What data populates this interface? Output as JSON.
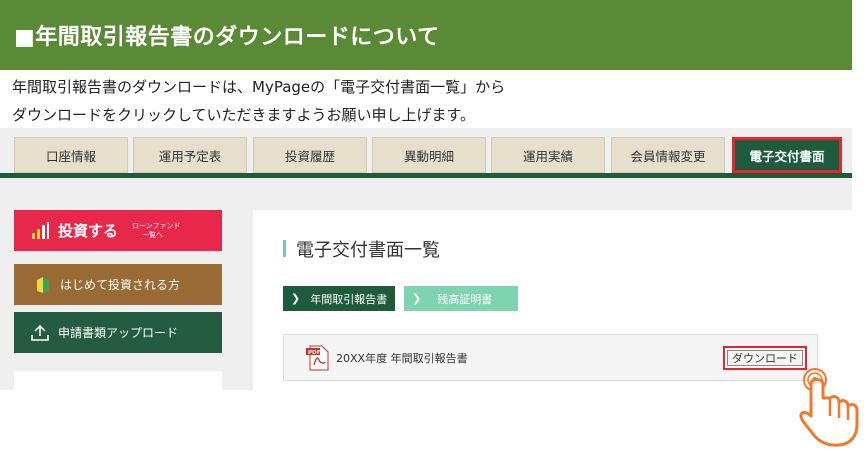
{
  "banner": {
    "title": "■年間取引報告書のダウンロードについて"
  },
  "intro": {
    "line1": "年間取引報告書のダウンロードは、MyPageの「電子交付書面一覧」から",
    "line2": "ダウンロードをクリックしていただきますようお願い申し上げます。"
  },
  "tabs": [
    {
      "label": "口座情報"
    },
    {
      "label": "運用予定表"
    },
    {
      "label": "投資履歴"
    },
    {
      "label": "異動明細"
    },
    {
      "label": "運用実績"
    },
    {
      "label": "会員情報変更"
    },
    {
      "label": "電子交付書面",
      "active": true
    }
  ],
  "sidebar": {
    "invest_label": "投資する",
    "invest_sub_line1": "ローンファンド",
    "invest_sub_line2": "一覧へ",
    "beginner_label": "はじめて投資される方",
    "upload_label": "申請書類アップロード"
  },
  "panel": {
    "title": "電子交付書面一覧",
    "subtabs": [
      {
        "label": "年間取引報告書",
        "active": true
      },
      {
        "label": "残高証明書",
        "active": false
      }
    ],
    "document": {
      "pdf_badge": "PDF",
      "name": "20XX年度 年間取引報告書",
      "download_label": "ダウンロード"
    }
  },
  "colors": {
    "banner_green": "#5a8a36",
    "nav_dark_green": "#1e5a3c",
    "tab_beige": "#e6dfcb",
    "highlight_red": "#e5262f",
    "invest_red": "#e8284a",
    "beginner_brown": "#9a6a34",
    "subtab_mint": "#7ed3b1",
    "hand_orange": "#f07a2a"
  },
  "icons": {
    "invest": "bar-chart-icon",
    "beginner": "beginner-leaf-icon",
    "upload": "upload-icon",
    "document": "pdf-file-icon",
    "pointer": "pointing-hand-icon"
  }
}
